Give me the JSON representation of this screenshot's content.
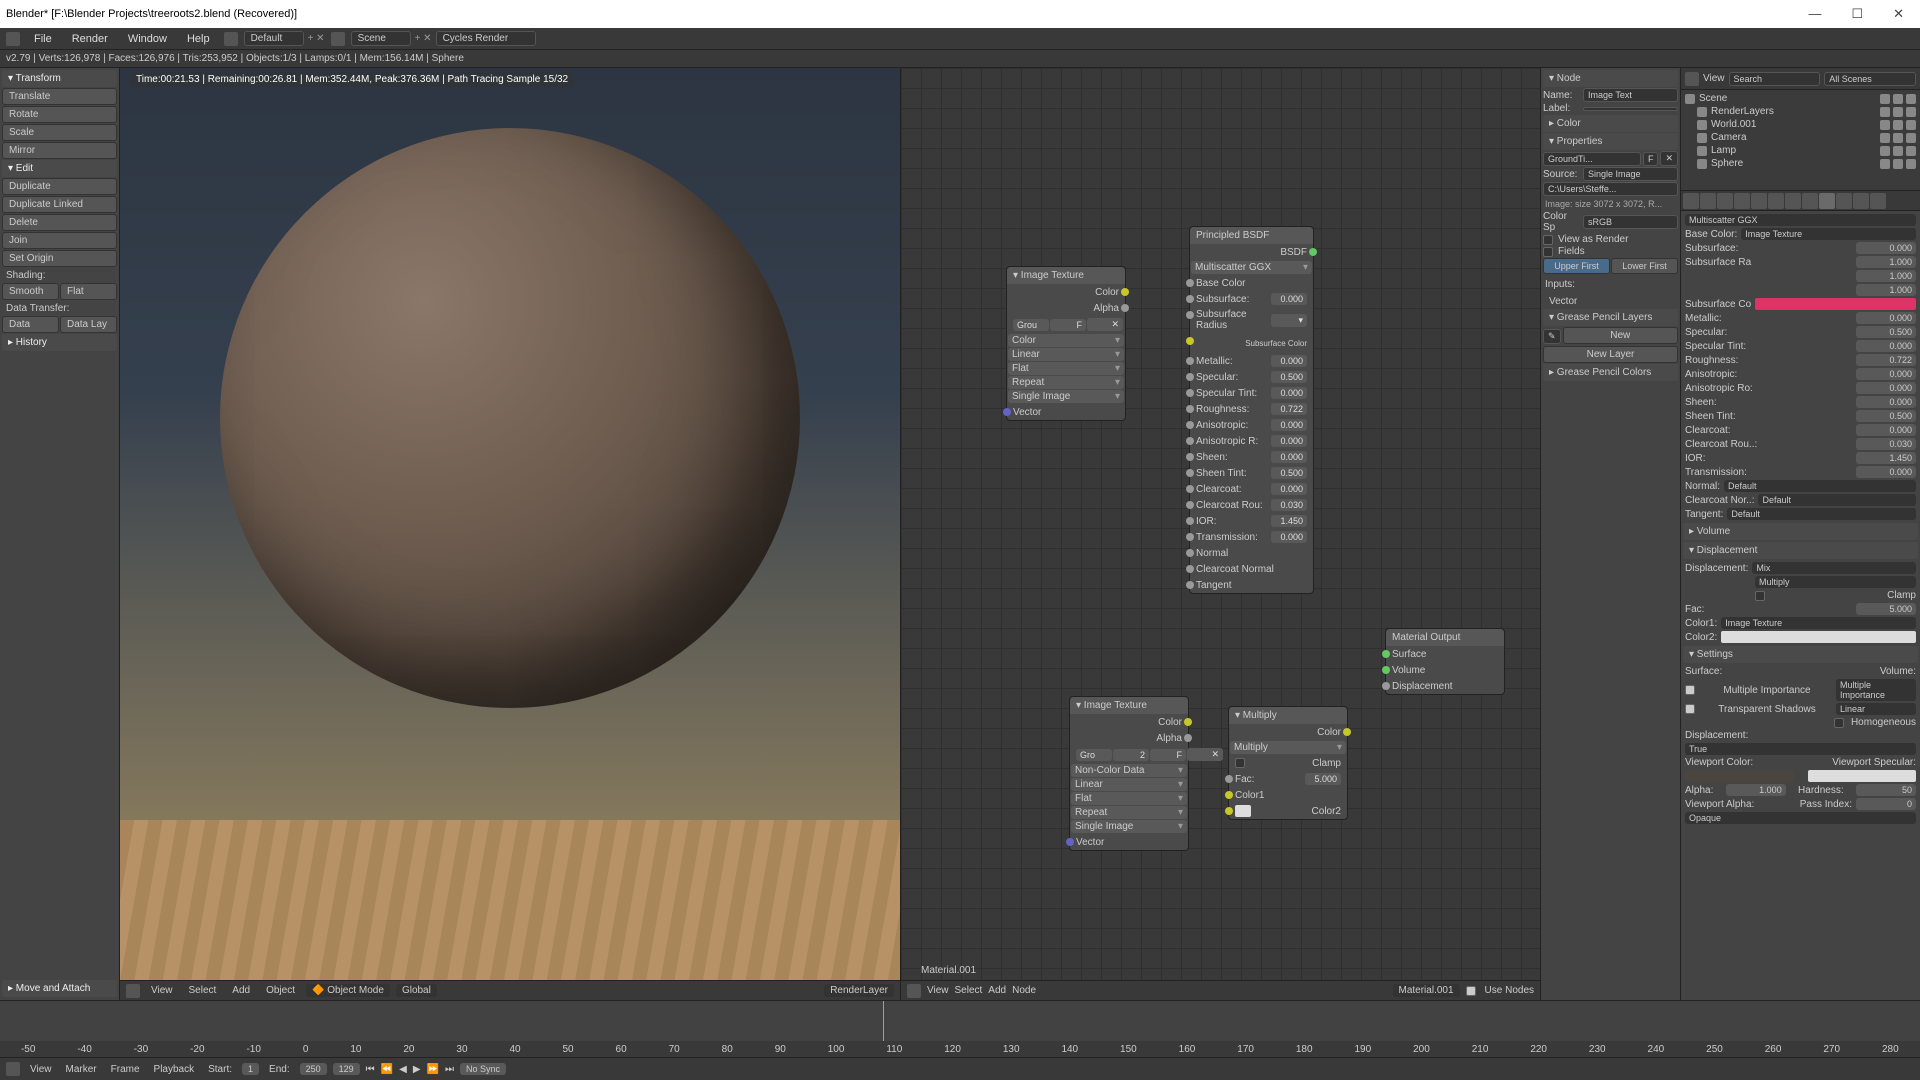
{
  "title": "Blender* [F:\\Blender Projects\\treeroots2.blend (Recovered)]",
  "menu": [
    "File",
    "Render",
    "Window",
    "Help"
  ],
  "layout": "Default",
  "scene": "Scene",
  "engine": "Cycles Render",
  "infobar": "v2.79 | Verts:126,978 | Faces:126,976 | Tris:253,952 | Objects:1/3 | Lamps:0/1 | Mem:156.14M | Sphere",
  "render_status": "Time:00:21.53 | Remaining:00:26.81 | Mem:352.44M, Peak:376.36M | Path Tracing Sample 15/32",
  "toolshelf": {
    "transform_hdr": "▾ Transform",
    "transform": [
      "Translate",
      "Rotate",
      "Scale",
      "Mirror"
    ],
    "edit_hdr": "▾ Edit",
    "edit": [
      "Duplicate",
      "Duplicate Linked",
      "Delete"
    ],
    "join": "Join",
    "set_origin": "Set Origin",
    "shading_hdr": "Shading:",
    "shading": [
      "Smooth",
      "Flat"
    ],
    "datatrans_hdr": "Data Transfer:",
    "datatrans": [
      "Data",
      "Data Lay"
    ],
    "history_hdr": "▸ History",
    "footer": "▸ Move and Attach"
  },
  "viewport_footer": {
    "items": [
      "View",
      "Select",
      "Add",
      "Object"
    ],
    "mode": "Object Mode",
    "orient": "Global",
    "layer": "RenderLayer"
  },
  "node_editor": {
    "matname": "Material.001",
    "footer": [
      "View",
      "Select",
      "Add",
      "Node"
    ],
    "use_nodes": "Use Nodes",
    "image_texture": {
      "title": "▾ Image Texture",
      "color": "Color",
      "alpha": "Alpha",
      "src": "Grou",
      "rows": [
        "Color",
        "Linear",
        "Flat",
        "Repeat",
        "Single Image"
      ],
      "vector": "Vector"
    },
    "image_texture2": {
      "title": "▾ Image Texture",
      "color": "Color",
      "alpha": "Alpha",
      "src": "Gro",
      "num": "2",
      "rows": [
        "Non-Color Data",
        "Linear",
        "Flat",
        "Repeat",
        "Single Image"
      ],
      "vector": "Vector"
    },
    "bsdf": {
      "title": "Principled BSDF",
      "out": "BSDF",
      "dist": "Multiscatter GGX",
      "rows": [
        {
          "l": "Base Color"
        },
        {
          "l": "Subsurface:",
          "v": "0.000"
        },
        {
          "l": "Subsurface Radius",
          "dd": true
        },
        {
          "l": "Subsurface Color",
          "red": true
        },
        {
          "l": "Metallic:",
          "v": "0.000"
        },
        {
          "l": "Specular:",
          "v": "0.500"
        },
        {
          "l": "Specular Tint:",
          "v": "0.000"
        },
        {
          "l": "Roughness:",
          "v": "0.722"
        },
        {
          "l": "Anisotropic:",
          "v": "0.000"
        },
        {
          "l": "Anisotropic R:",
          "v": "0.000"
        },
        {
          "l": "Sheen:",
          "v": "0.000"
        },
        {
          "l": "Sheen Tint:",
          "v": "0.500"
        },
        {
          "l": "Clearcoat:",
          "v": "0.000"
        },
        {
          "l": "Clearcoat Rou:",
          "v": "0.030"
        },
        {
          "l": "IOR:",
          "v": "1.450"
        },
        {
          "l": "Transmission:",
          "v": "0.000"
        },
        {
          "l": "Normal"
        },
        {
          "l": "Clearcoat Normal"
        },
        {
          "l": "Tangent"
        }
      ]
    },
    "multiply": {
      "title": "▾ Multiply",
      "color": "Color",
      "blend": "Multiply",
      "clamp": "Clamp",
      "fac": "Fac:",
      "facv": "5.000",
      "c1": "Color1",
      "c2": "Color2"
    },
    "matout": {
      "title": "Material Output",
      "rows": [
        "Surface",
        "Volume",
        "Displacement"
      ]
    }
  },
  "npanel": {
    "node_hdr": "▾ Node",
    "name_lbl": "Name:",
    "name_val": "Image Text",
    "label_lbl": "Label:",
    "color_hdr": "▸ Color",
    "props_hdr": "▾ Properties",
    "slot": "GroundTi...",
    "source_lbl": "Source:",
    "source_val": "Single Image",
    "path": "C:\\Users\\Steffe...",
    "imginfo": "Image: size 3072 x 3072, R...",
    "colorsp_lbl": "Color Sp",
    "colorsp_val": "sRGB",
    "view_as_render": "View as Render",
    "fields": "Fields",
    "upper": "Upper First",
    "lower": "Lower First",
    "inputs": "Inputs:",
    "vector": "Vector",
    "gpl_hdr": "▾ Grease Pencil Layers",
    "new": "New",
    "newlayer": "New Layer",
    "gpc_hdr": "▸ Grease Pencil Colors"
  },
  "outliner": {
    "view": "View",
    "search_ph": "Search",
    "scenesel": "All Scenes",
    "items": [
      {
        "n": "Scene",
        "i": 0
      },
      {
        "n": "RenderLayers",
        "i": 1
      },
      {
        "n": "World.001",
        "i": 1
      },
      {
        "n": "Camera",
        "i": 1
      },
      {
        "n": "Lamp",
        "i": 1
      },
      {
        "n": "Sphere",
        "i": 1
      }
    ]
  },
  "props": {
    "dist": "Multiscatter GGX",
    "rows": [
      {
        "l": "Base Color:",
        "sel": "Image Texture"
      },
      {
        "l": "Subsurface:",
        "v": "0.000"
      },
      {
        "l": "Subsurface Ra",
        "v": "1.000"
      },
      {
        "l": "",
        "v": "1.000"
      },
      {
        "l": "",
        "v": "1.000"
      },
      {
        "l": "Subsurface Co",
        "red": true
      },
      {
        "l": "Metallic:",
        "v": "0.000"
      },
      {
        "l": "Specular:",
        "v": "0.500"
      },
      {
        "l": "Specular Tint:",
        "v": "0.000"
      },
      {
        "l": "Roughness:",
        "v": "0.722"
      },
      {
        "l": "Anisotropic:",
        "v": "0.000"
      },
      {
        "l": "Anisotropic Ro:",
        "v": "0.000"
      },
      {
        "l": "Sheen:",
        "v": "0.000"
      },
      {
        "l": "Sheen Tint:",
        "v": "0.500"
      },
      {
        "l": "Clearcoat:",
        "v": "0.000"
      },
      {
        "l": "Clearcoat Rou..:",
        "v": "0.030"
      },
      {
        "l": "IOR:",
        "v": "1.450"
      },
      {
        "l": "Transmission:",
        "v": "0.000"
      },
      {
        "l": "Normal:",
        "sel": "Default"
      },
      {
        "l": "Clearcoat Nor..:",
        "sel": "Default"
      },
      {
        "l": "Tangent:",
        "sel": "Default"
      }
    ],
    "volume": "▸ Volume",
    "disp_hdr": "▾ Displacement",
    "disp_lbl": "Displacement:",
    "disp_sel": "Mix",
    "disp_sel2": "Multiply",
    "clamp": "Clamp",
    "fac_lbl": "Fac:",
    "fac_val": "5.000",
    "c1_lbl": "Color1:",
    "c1_sel": "Image Texture",
    "c2_lbl": "Color2:",
    "settings_hdr": "▾ Settings",
    "surface_lbl": "Surface:",
    "volume_lbl": "Volume:",
    "mi": "Multiple Importance",
    "mi2": "Multiple Importance",
    "ts": "Transparent Shadows",
    "linear": "Linear",
    "homog": "Homogeneous",
    "disp2_lbl": "Displacement:",
    "disp2_sel": "True",
    "vpc_lbl": "Viewport Color:",
    "vps_lbl": "Viewport Specular:",
    "alpha_lbl": "Alpha:",
    "alpha_v": "1.000",
    "hard_lbl": "Hardness:",
    "hard_v": "50",
    "vpa_lbl": "Viewport Alpha:",
    "pass_lbl": "Pass Index:",
    "pass_v": "0",
    "opaque": "Opaque"
  },
  "timeline": {
    "ticks": [
      "-50",
      "-40",
      "-30",
      "-20",
      "-10",
      "0",
      "10",
      "20",
      "30",
      "40",
      "50",
      "60",
      "70",
      "80",
      "90",
      "100",
      "110",
      "120",
      "130",
      "140",
      "150",
      "160",
      "170",
      "180",
      "190",
      "200",
      "210",
      "220",
      "230",
      "240",
      "250",
      "260",
      "270",
      "280"
    ],
    "footer": [
      "View",
      "Marker",
      "Frame",
      "Playback"
    ],
    "start_lbl": "Start:",
    "start": "1",
    "end_lbl": "End:",
    "end": "250",
    "frame": "129",
    "nosync": "No Sync"
  }
}
